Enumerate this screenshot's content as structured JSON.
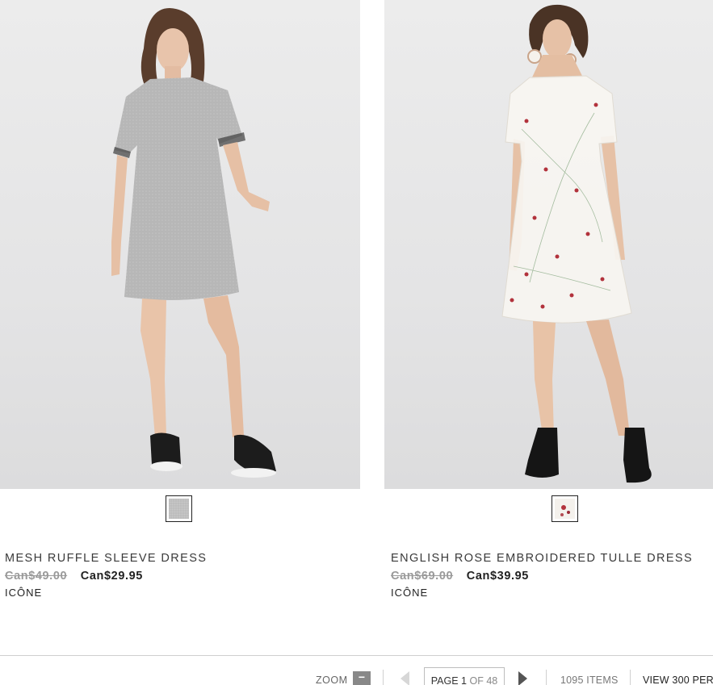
{
  "products": [
    {
      "name": "MESH RUFFLE SLEEVE DRESS",
      "old_price": "Can$49.00",
      "sale_price": "Can$29.95",
      "brand": "ICÔNE",
      "swatch_color": "#bdbdbd"
    },
    {
      "name": "ENGLISH ROSE EMBROIDERED TULLE DRESS",
      "old_price": "Can$69.00",
      "sale_price": "Can$39.95",
      "brand": "ICÔNE",
      "swatch_color": "#f4f1ec"
    }
  ],
  "pager": {
    "zoom_label": "ZOOM",
    "zoom_button": "−",
    "page_prefix": "PAGE",
    "current_page": "1",
    "of_total": "OF 48",
    "items_count": "1095 ITEMS",
    "view_per": "VIEW 300 PER"
  }
}
